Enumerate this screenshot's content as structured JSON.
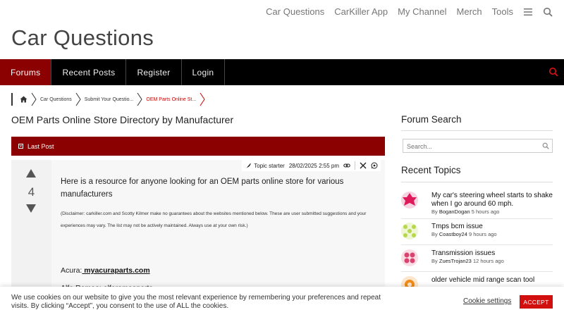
{
  "top_nav": {
    "links": [
      "Car Questions",
      "CarKiller App",
      "My Channel",
      "Merch",
      "Tools"
    ],
    "icons": [
      "menu-icon",
      "search-icon"
    ]
  },
  "site": {
    "title": "Car Questions"
  },
  "forum_nav": {
    "items": [
      "Forums",
      "Recent Posts",
      "Register",
      "Login"
    ],
    "active": "Forums",
    "accent": "#8b0000"
  },
  "breadcrumb": {
    "items": [
      "Car Questions",
      "Submit Your Questio...",
      "OEM Parts Online St..."
    ]
  },
  "topic": {
    "title": "OEM Parts Online Store Directory by Manufacturer",
    "header_label": "Last Post"
  },
  "post": {
    "votes": "4",
    "badge": "Topic starter",
    "date": "28/02/2025 2:55 pm",
    "intro": "Here is a resource for anyone looking for an OEM parts online store for various manufacturers",
    "disclaimer": "(Disclaimer: carkiller.com and Scotty Kilmer make no guarantees about the websites mentioned below. These are user submitted suggestions and your experiences may vary. The list may not be actively maintained. Always use at your own risk.)",
    "link_label": "Acura:",
    "link_text": " myacuraparts.com",
    "cut_line": "Alfa Romeo: alfaromeoparts..."
  },
  "sidebar": {
    "search_title": "Forum Search",
    "search_placeholder": "Search...",
    "recent_title": "Recent Topics",
    "topics": [
      {
        "title": "My car's steering wheel starts to shake when I go around 60 mph.",
        "by": "By",
        "author": "BoganDogan",
        "time": "5 hours ago",
        "avatar_color": "#e0195a"
      },
      {
        "title": "Tmps bcm issue",
        "by": "By",
        "author": "Coastboy24",
        "time": "9 hours ago",
        "avatar_color": "#b6d84a"
      },
      {
        "title": "Transmission issues",
        "by": "By",
        "author": "ZuesTrojan23",
        "time": "12 hours ago",
        "avatar_color": "#d9436f"
      },
      {
        "title": "older vehicle mid range scan tool",
        "by": "",
        "author": "",
        "time": "",
        "avatar_color": "#f08c1a"
      }
    ]
  },
  "cookie": {
    "text": "We use cookies on our website to give you the most relevant experience by remembering your preferences and repeat visits. By clicking “Accept”, you consent to the use of ALL the cookies.",
    "settings": "Cookie settings",
    "accept": "ACCEPT",
    "accept_color": "#d10f0f"
  }
}
